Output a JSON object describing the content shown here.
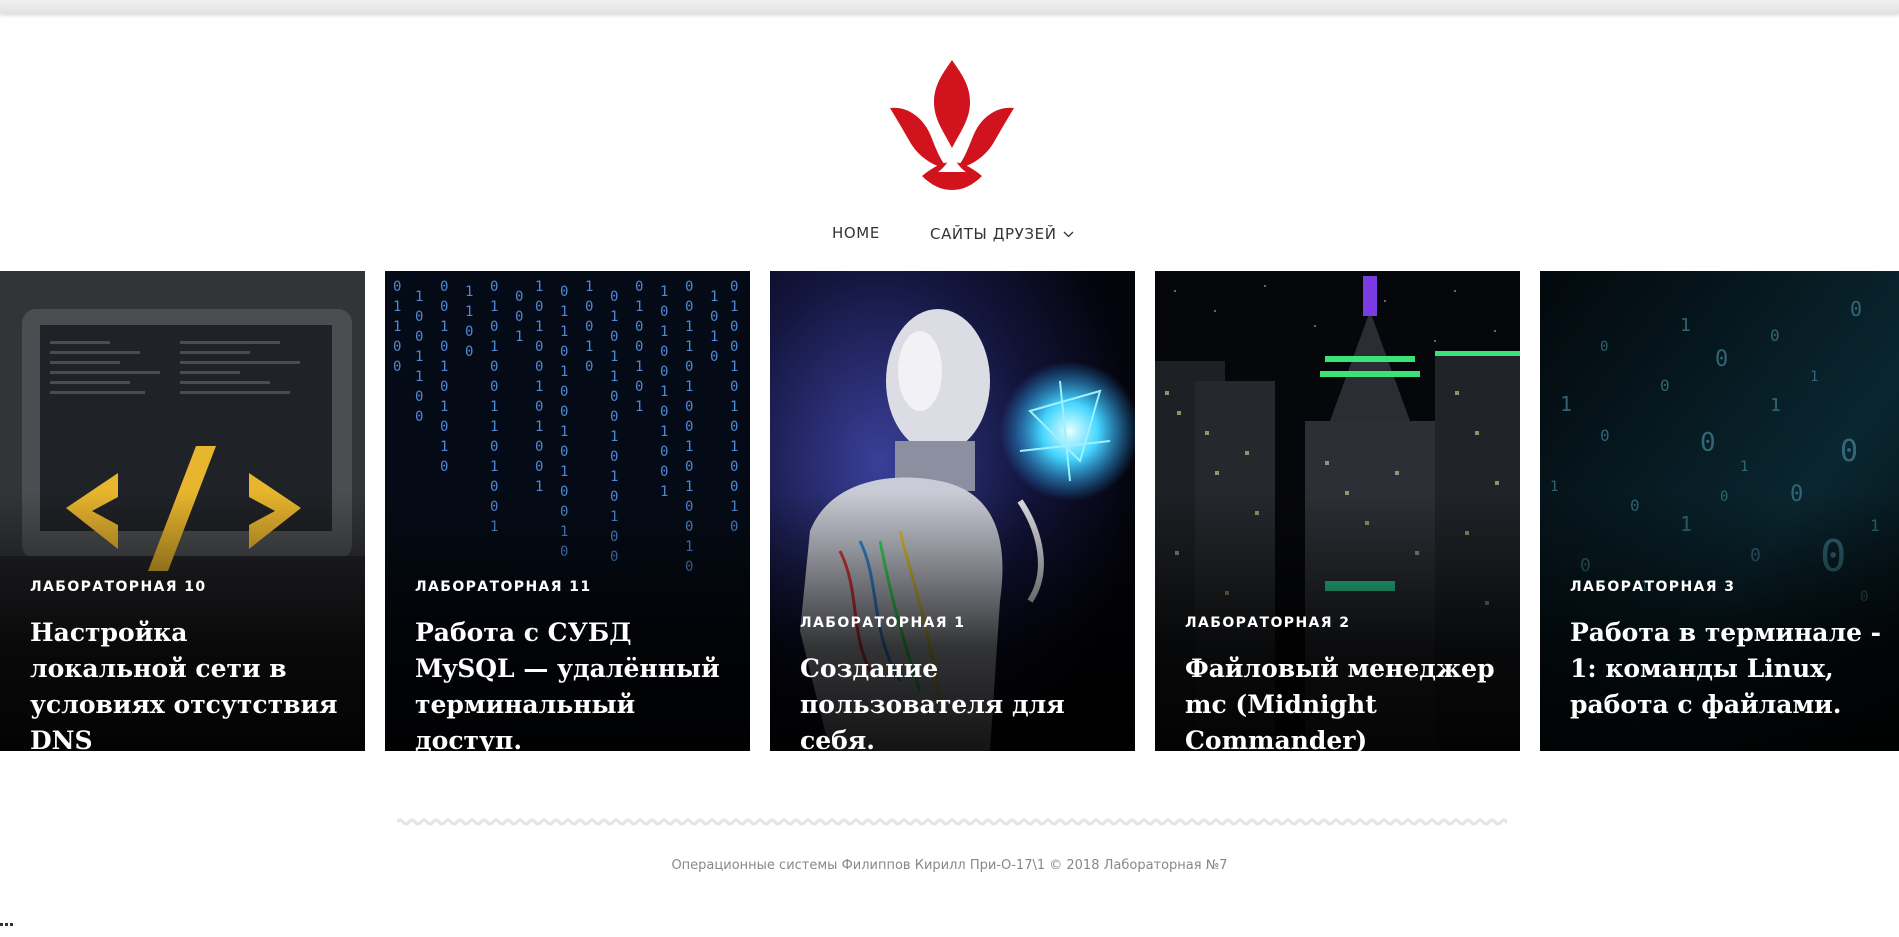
{
  "colors": {
    "brand": "#d0131d",
    "accent_code": "#e8b52e",
    "footer_text": "#888888"
  },
  "logo": {
    "icon": "fleur-de-lis-icon"
  },
  "nav": {
    "home_label": "HOME",
    "friends_label": "САЙТЫ ДРУЗЕЙ",
    "friends_icon": "chevron-down-icon"
  },
  "posts": [
    {
      "category": "ЛАБОРАТОРНАЯ 10",
      "title": "Настройка локальной сети в условиях отсутствия DNS",
      "image": "laptop-code-icon"
    },
    {
      "category": "ЛАБОРАТОРНАЯ 11",
      "title": "Работа с СУБД MySQL — удалённый терминальный доступ.",
      "image": "binary-rain-icon"
    },
    {
      "category": "ЛАБОРАТОРНАЯ 1",
      "title": "Создание пользователя для себя.",
      "image": "robot-icon"
    },
    {
      "category": "ЛАБОРАТОРНАЯ 2",
      "title": "Файловый менеджер mc (Midnight Commander)",
      "image": "night-city-icon"
    },
    {
      "category": "ЛАБОРАТОРНАЯ 3",
      "title": "Работа в терминале - 1: команды Linux, работа с файлами.",
      "image": "binary-digits-icon"
    }
  ],
  "footer": {
    "text": "Операционные системы Филиппов Кирилл При-О-17\\1 © 2018 Лабораторная №7"
  }
}
